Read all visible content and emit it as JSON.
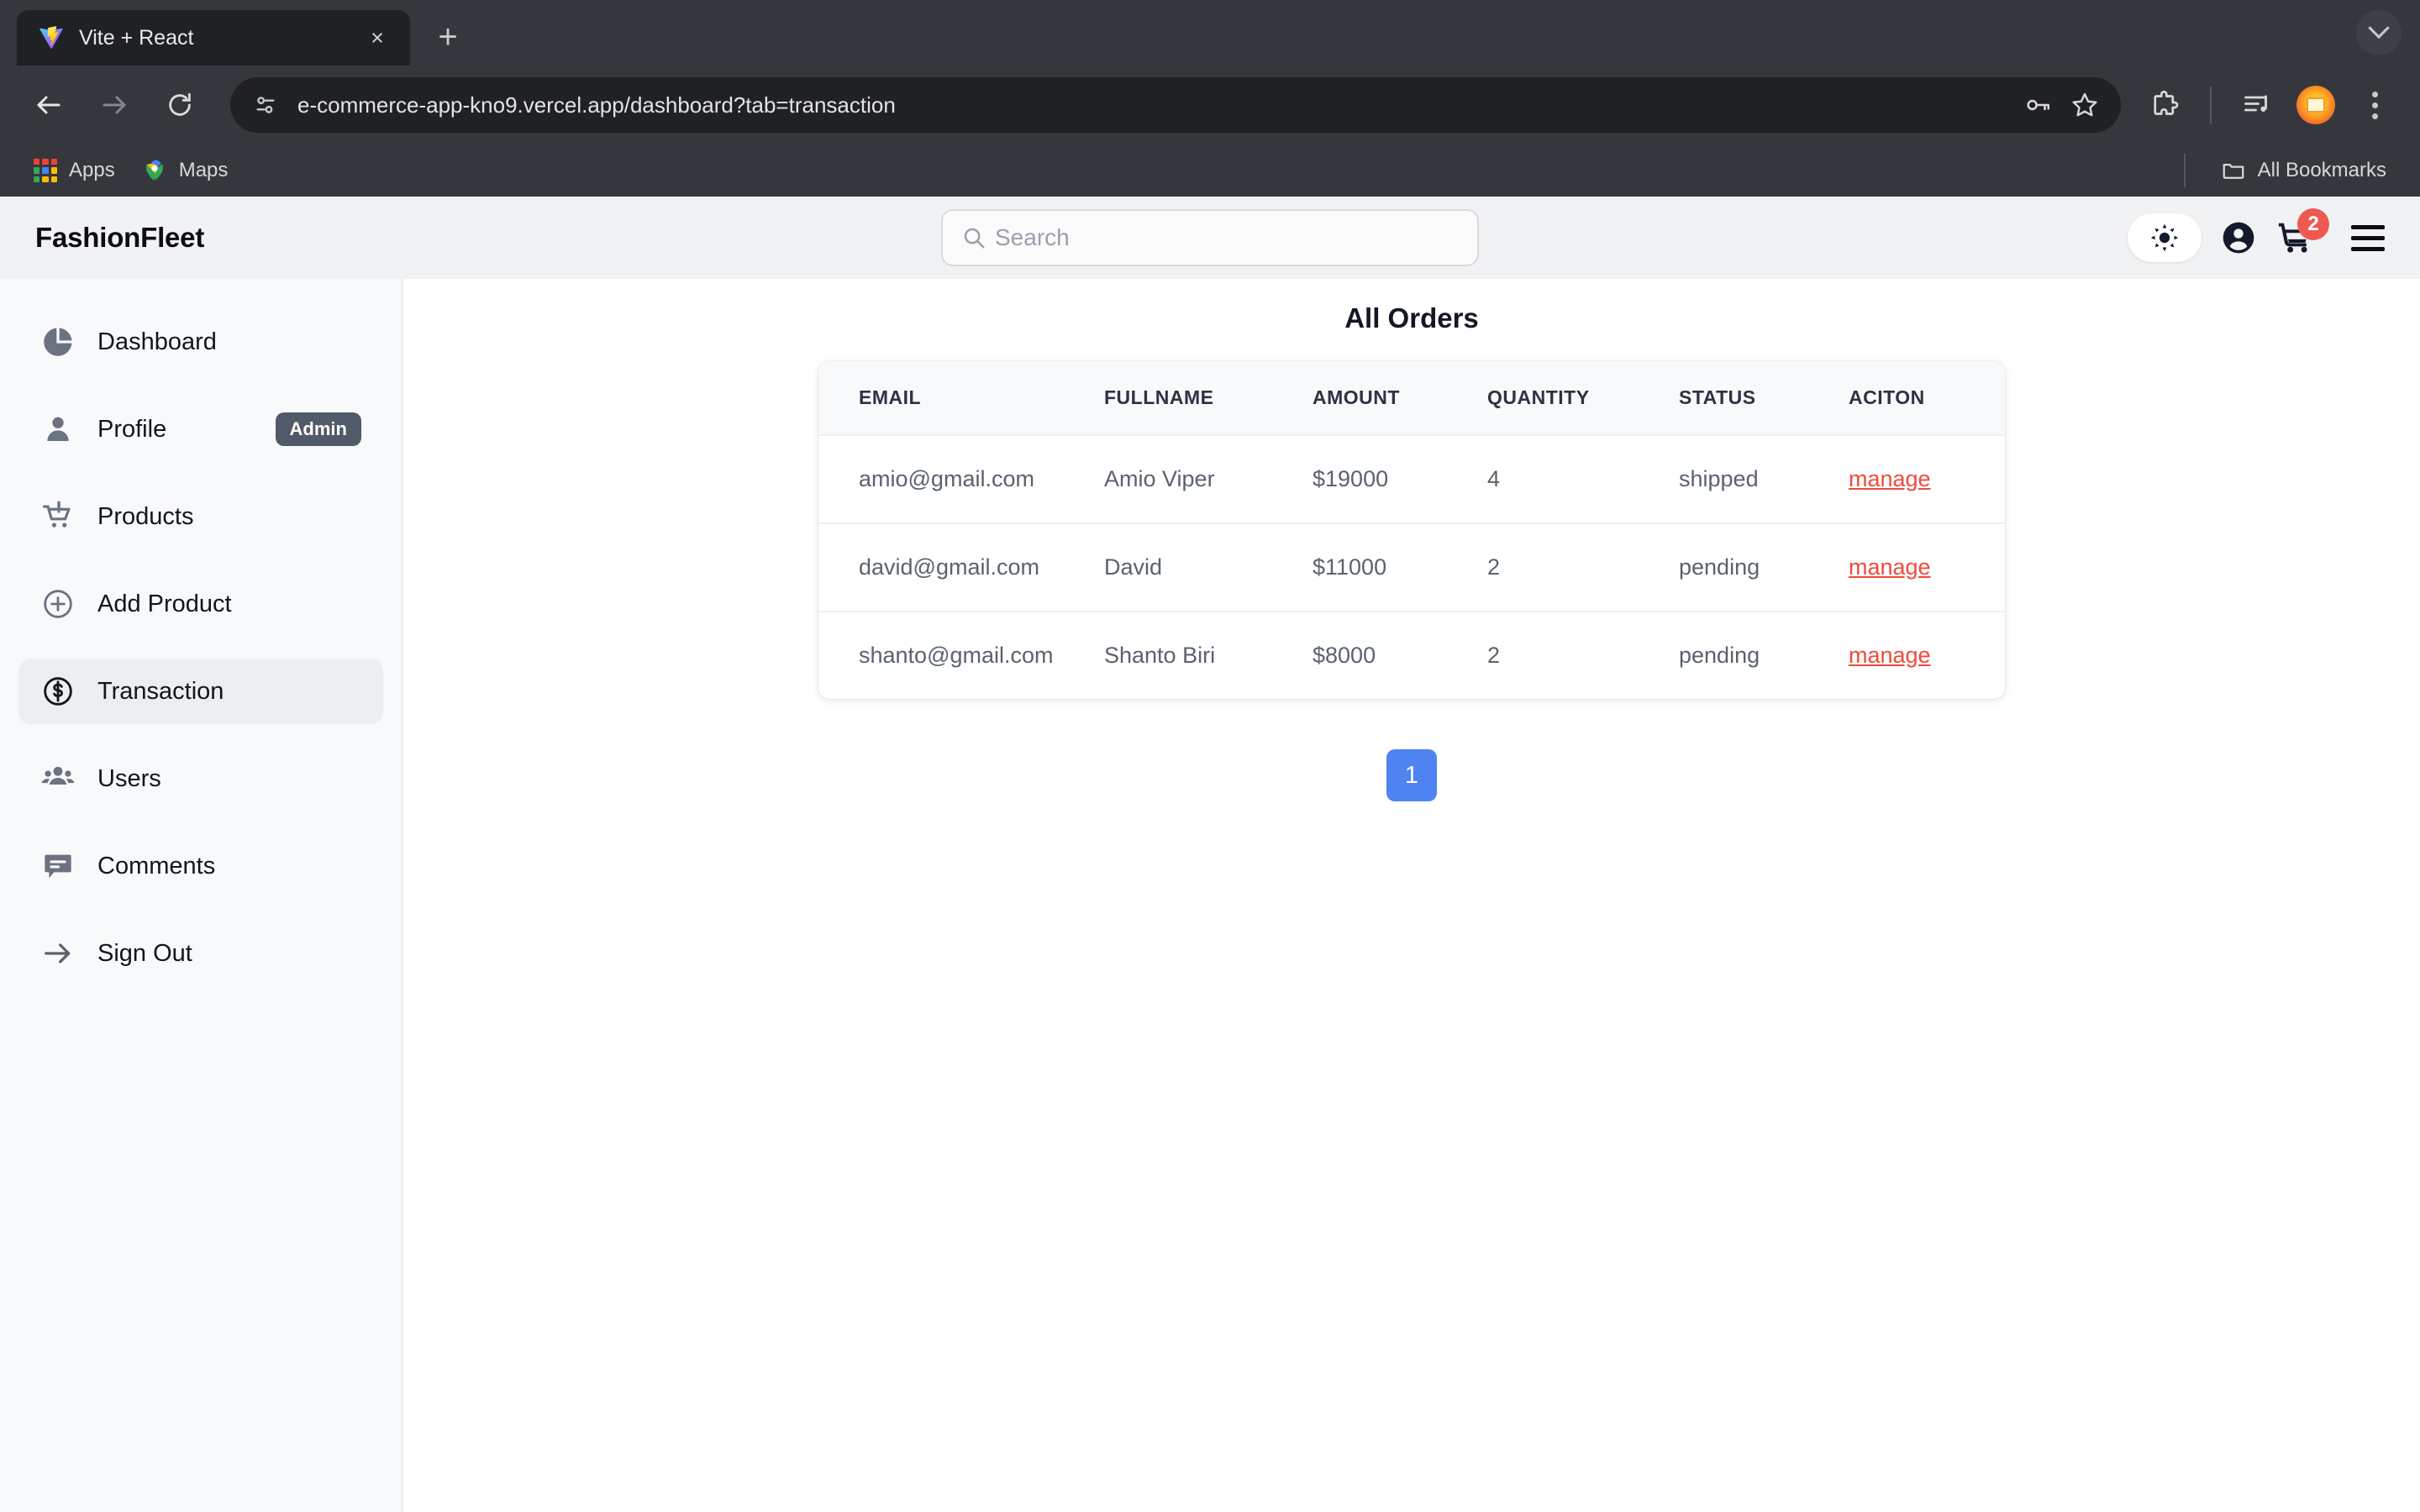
{
  "browser": {
    "tab": {
      "title": "Vite + React",
      "favicon": "vite-logo-icon",
      "close_label": "×"
    },
    "new_tab_label": "+",
    "nav": {
      "back": "back-arrow",
      "forward": "forward-arrow",
      "reload": "reload-icon"
    },
    "omnibox": {
      "url": "e-commerce-app-kno9.vercel.app/dashboard?tab=transaction",
      "site_info_icon": "site-settings-icon",
      "password_icon": "key-icon",
      "bookmark_icon": "star-icon"
    },
    "toolbar_icons": [
      "extensions-puzzle-icon",
      "media-playlist-icon",
      "profile-avatar",
      "three-dot-menu-icon"
    ],
    "bookmarks": [
      {
        "label": "Apps",
        "icon": "apps-grid-icon"
      },
      {
        "label": "Maps",
        "icon": "google-maps-pin-icon"
      }
    ],
    "all_bookmarks": {
      "label": "All Bookmarks",
      "icon": "folder-icon"
    }
  },
  "header": {
    "brand": "FashionFleet",
    "search": {
      "value": "",
      "placeholder": "Search",
      "icon": "search-icon"
    },
    "theme_toggle_icon": "sun-icon",
    "account_icon": "account-circle-icon",
    "cart": {
      "icon": "shopping-cart-icon",
      "count": "2"
    },
    "menu_icon": "hamburger-menu-icon"
  },
  "sidebar": {
    "items": [
      {
        "label": "Dashboard",
        "icon": "pie-chart-icon",
        "active": false,
        "badge": null
      },
      {
        "label": "Profile",
        "icon": "person-icon",
        "active": false,
        "badge": "Admin"
      },
      {
        "label": "Products",
        "icon": "cart-alert-icon",
        "active": false,
        "badge": null
      },
      {
        "label": "Add Product",
        "icon": "plus-circle-icon",
        "active": false,
        "badge": null
      },
      {
        "label": "Transaction",
        "icon": "dollar-circle-icon",
        "active": true,
        "badge": null
      },
      {
        "label": "Users",
        "icon": "people-group-icon",
        "active": false,
        "badge": null
      },
      {
        "label": "Comments",
        "icon": "chat-bubble-icon",
        "active": false,
        "badge": null
      },
      {
        "label": "Sign Out",
        "icon": "arrow-right-icon",
        "active": false,
        "badge": null
      }
    ]
  },
  "main": {
    "title": "All Orders",
    "table": {
      "columns": [
        "EMAIL",
        "FULLNAME",
        "AMOUNT",
        "QUANTITY",
        "STATUS",
        "ACITON"
      ],
      "rows": [
        {
          "email": "amio@gmail.com",
          "fullname": "Amio Viper",
          "amount": "$19000",
          "quantity": "4",
          "status": "shipped",
          "action": "manage"
        },
        {
          "email": "david@gmail.com",
          "fullname": "David",
          "amount": "$11000",
          "quantity": "2",
          "status": "pending",
          "action": "manage"
        },
        {
          "email": "shanto@gmail.com",
          "fullname": "Shanto Biri",
          "amount": "$8000",
          "quantity": "2",
          "status": "pending",
          "action": "manage"
        }
      ]
    },
    "pagination": {
      "pages": [
        "1"
      ],
      "current": "1"
    }
  },
  "colors": {
    "accent_blue": "#4f83f1",
    "action_red": "#ef4b3c",
    "badge_red": "#ee5a52",
    "sidebar_bg": "#f8f9fb",
    "header_bg": "#f1f2f4",
    "admin_badge_bg": "#515a68"
  }
}
